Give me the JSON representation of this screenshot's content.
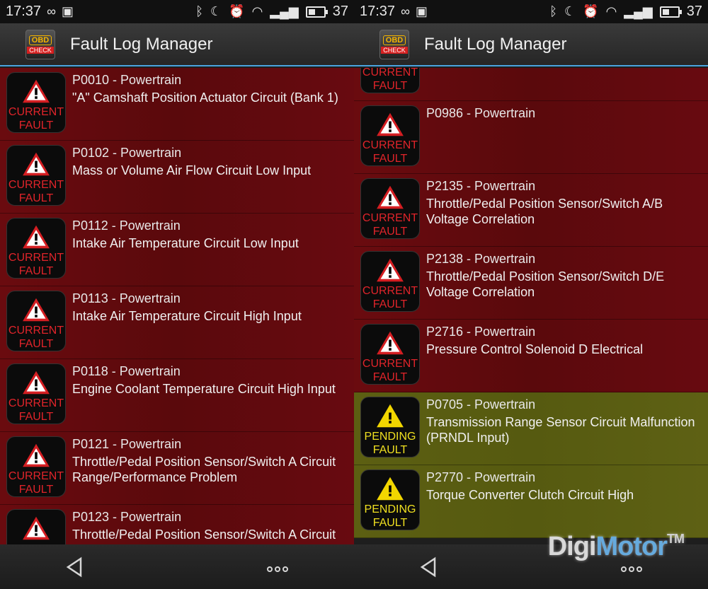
{
  "status_bar": {
    "time": "17:37",
    "battery_text": "37",
    "battery_level_pct": 37
  },
  "app": {
    "title": "Fault Log Manager",
    "icon_label_top": "OBD",
    "icon_label_bottom": "CHECK"
  },
  "badges": {
    "current_line1": "CURRENT",
    "current_line2": "FAULT",
    "pending_line1": "PENDING",
    "pending_line2": "FAULT"
  },
  "colors": {
    "current_row": "#5e0a0d",
    "pending_row": "#595c12",
    "accent_line": "#4aa3df",
    "current_badge_text": "#e0242a",
    "pending_badge_text": "#f0e020"
  },
  "left_screen": {
    "faults": [
      {
        "code": "P0010 - Powertrain",
        "desc": "\"A\" Camshaft Position Actuator Circuit (Bank 1)",
        "status": "current"
      },
      {
        "code": "P0102 - Powertrain",
        "desc": "Mass or Volume Air Flow Circuit Low Input",
        "status": "current"
      },
      {
        "code": "P0112 - Powertrain",
        "desc": "Intake Air Temperature Circuit Low Input",
        "status": "current"
      },
      {
        "code": "P0113 - Powertrain",
        "desc": "Intake Air Temperature Circuit High Input",
        "status": "current"
      },
      {
        "code": "P0118 - Powertrain",
        "desc": "Engine Coolant Temperature Circuit High Input",
        "status": "current"
      },
      {
        "code": "P0121 - Powertrain",
        "desc": "Throttle/Pedal Position Sensor/Switch A Circuit Range/Performance Problem",
        "status": "current"
      },
      {
        "code": "P0123 - Powertrain",
        "desc": "Throttle/Pedal Position Sensor/Switch A Circuit",
        "status": "current"
      }
    ]
  },
  "right_screen": {
    "faults": [
      {
        "code": "",
        "desc": "",
        "status": "current"
      },
      {
        "code": "P0986 - Powertrain",
        "desc": "",
        "status": "current"
      },
      {
        "code": "P2135 - Powertrain",
        "desc": "Throttle/Pedal Position Sensor/Switch A/B Voltage Correlation",
        "status": "current"
      },
      {
        "code": "P2138 - Powertrain",
        "desc": "Throttle/Pedal Position Sensor/Switch D/E Voltage Correlation",
        "status": "current"
      },
      {
        "code": "P2716 - Powertrain",
        "desc": "Pressure Control Solenoid D Electrical",
        "status": "current"
      },
      {
        "code": "P0705 - Powertrain",
        "desc": "Transmission Range Sensor Circuit Malfunction (PRNDL Input)",
        "status": "pending"
      },
      {
        "code": "P2770 - Powertrain",
        "desc": "Torque Converter Clutch Circuit High",
        "status": "pending"
      }
    ]
  },
  "watermark": {
    "part1": "Digi",
    "part2": "Motor",
    "tm": "TM"
  }
}
